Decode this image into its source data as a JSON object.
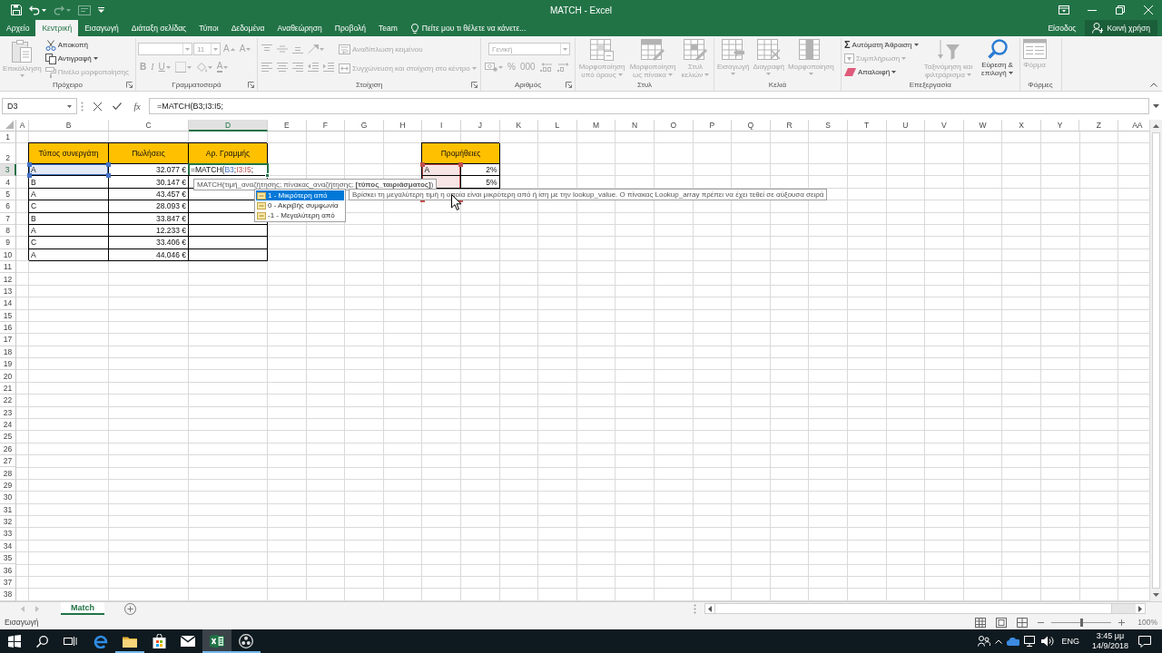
{
  "title_bar": {
    "title": "MATCH - Excel",
    "quick_access": [
      {
        "disabled": false
      },
      {
        "disabled": false
      },
      {
        "disabled": true
      },
      {
        "disabled": true
      },
      {
        "disabled": false
      }
    ]
  },
  "ribbon_tabs": [
    {
      "label": "Αρχείο",
      "selected": false
    },
    {
      "label": "Κεντρική",
      "selected": true
    },
    {
      "label": "Εισαγωγή",
      "selected": false
    },
    {
      "label": "Διάταξη σελίδας",
      "selected": false
    },
    {
      "label": "Τύποι",
      "selected": false
    },
    {
      "label": "Δεδομένα",
      "selected": false
    },
    {
      "label": "Αναθεώρηση",
      "selected": false
    },
    {
      "label": "Προβολή",
      "selected": false
    },
    {
      "label": "Team",
      "selected": false
    }
  ],
  "tell_me": {
    "label": "Πείτε μου τι θέλετε να κάνετε..."
  },
  "account": {
    "sign_in": "Είσοδος",
    "share": "Κοινή χρήση"
  },
  "ribbon_groups": [
    {
      "label": "Πρόχειρο",
      "launcher": true,
      "columns": [
        {
          "rows": [
            [
              {
                "kind": "large",
                "label": "Επικόλληση",
                "disabled": true
              }
            ]
          ]
        },
        {
          "rows": [
            [
              {
                "kind": "small",
                "label": "Αποκοπή",
                "disabled": false
              }
            ],
            [
              {
                "kind": "small",
                "label": "Αντιγραφή",
                "disabled": false
              }
            ],
            [
              {
                "kind": "small",
                "label": "Πινέλο μορφοποίησης",
                "disabled": true
              }
            ]
          ]
        }
      ]
    },
    {
      "label": "Γραμματοσειρά",
      "launcher": true,
      "columns": [
        {
          "rows": [
            [
              {
                "kind": "combo",
                "disabled": true
              },
              {
                "kind": "combo",
                "label": "11",
                "disabled": true
              },
              {
                "kind": "glyph",
                "label": "A",
                "disabled": true
              },
              {
                "kind": "glyph",
                "label": "A",
                "disabled": true
              }
            ],
            [
              {
                "kind": "glyph",
                "label": "B",
                "disabled": true
              },
              {
                "kind": "glyph",
                "label": "I",
                "disabled": true
              },
              {
                "kind": "glyph",
                "label": "U",
                "disabled": true
              },
              {
                "kind": "icon",
                "disabled": true
              },
              {
                "kind": "icon",
                "disabled": true
              },
              {
                "kind": "glyph",
                "label": "A",
                "disabled": true
              }
            ]
          ]
        }
      ]
    },
    {
      "label": "Στοίχιση",
      "launcher": true,
      "columns": [
        {
          "rows": [
            [
              {
                "kind": "icon",
                "disabled": true
              },
              {
                "kind": "icon",
                "disabled": true
              },
              {
                "kind": "icon",
                "disabled": true
              },
              {
                "kind": "icon",
                "disabled": true
              }
            ],
            [
              {
                "kind": "icon",
                "disabled": true
              },
              {
                "kind": "icon",
                "disabled": true
              },
              {
                "kind": "icon",
                "disabled": true
              },
              {
                "kind": "icon",
                "disabled": true
              },
              {
                "kind": "icon",
                "disabled": true
              }
            ]
          ]
        },
        {
          "rows": [
            [
              {
                "kind": "small",
                "label": "Αναδίπλωση κειμένου",
                "disabled": true
              }
            ],
            [
              {
                "kind": "small",
                "label": "Συγχώνευση και στοίχιση στο κέντρο",
                "disabled": true
              }
            ]
          ]
        }
      ]
    },
    {
      "label": "Αριθμός",
      "launcher": true,
      "columns": [
        {
          "rows": [
            [
              {
                "kind": "combo",
                "label": "Γενική",
                "disabled": true
              }
            ],
            [
              {
                "kind": "icon",
                "disabled": true
              },
              {
                "kind": "glyph",
                "label": "%",
                "disabled": true
              },
              {
                "kind": "glyph",
                "label": "000",
                "disabled": true
              },
              {
                "kind": "icon",
                "disabled": true
              },
              {
                "kind": "icon",
                "disabled": true
              }
            ]
          ]
        }
      ]
    },
    {
      "label": "Στυλ",
      "launcher": false,
      "columns": [
        {
          "rows": [
            [
              {
                "kind": "large",
                "label": "Μορφοποίηση υπό όρους",
                "disabled": true
              }
            ]
          ]
        },
        {
          "rows": [
            [
              {
                "kind": "large",
                "label": "Μορφοποίηση ως πίνακα",
                "disabled": true
              }
            ]
          ]
        },
        {
          "rows": [
            [
              {
                "kind": "large",
                "label": "Στυλ κελιών",
                "disabled": true
              }
            ]
          ]
        }
      ]
    },
    {
      "label": "Κελιά",
      "launcher": false,
      "columns": [
        {
          "rows": [
            [
              {
                "kind": "large",
                "label": "Εισαγωγή",
                "disabled": true
              }
            ]
          ]
        },
        {
          "rows": [
            [
              {
                "kind": "large",
                "label": "Διαγραφή",
                "disabled": true
              }
            ]
          ]
        },
        {
          "rows": [
            [
              {
                "kind": "large",
                "label": "Μορφοποίηση",
                "disabled": true
              }
            ]
          ]
        }
      ]
    },
    {
      "label": "Επεξεργασία",
      "launcher": false,
      "columns": [
        {
          "rows": [
            [
              {
                "kind": "small",
                "glyph": "Σ",
                "label": "Αυτόματη Άθροιση",
                "disabled": false
              }
            ],
            [
              {
                "kind": "small",
                "label": "Συμπλήρωση",
                "disabled": true
              }
            ],
            [
              {
                "kind": "small",
                "label": "Απαλοιφή",
                "disabled": false
              }
            ]
          ]
        },
        {
          "rows": [
            [
              {
                "kind": "large",
                "label": "Ταξινόμηση και φιλτράρισμα",
                "disabled": true
              }
            ]
          ]
        },
        {
          "rows": [
            [
              {
                "kind": "large",
                "label": "Εύρεση & επιλογή",
                "disabled": false
              }
            ]
          ]
        }
      ]
    },
    {
      "label": "Φόρμες",
      "launcher": false,
      "columns": [
        {
          "rows": [
            [
              {
                "kind": "large",
                "label": "Φόρμα",
                "disabled": true
              }
            ]
          ]
        }
      ]
    }
  ],
  "formula_bar": {
    "name_box": "D3",
    "function_button": "fx",
    "formula": "=MATCH(B3;I3:I5;"
  },
  "sheet": {
    "column_headers": [
      {
        "label": "A",
        "selected": false
      },
      {
        "label": "B",
        "selected": false
      },
      {
        "label": "C",
        "selected": false
      },
      {
        "label": "D",
        "selected": true
      },
      {
        "label": "E",
        "selected": false
      },
      {
        "label": "F",
        "selected": false
      },
      {
        "label": "G",
        "selected": false
      },
      {
        "label": "H",
        "selected": false
      },
      {
        "label": "I",
        "selected": false
      },
      {
        "label": "J",
        "selected": false
      },
      {
        "label": "K",
        "selected": false
      },
      {
        "label": "L",
        "selected": false
      },
      {
        "label": "M",
        "selected": false
      },
      {
        "label": "N",
        "selected": false
      },
      {
        "label": "O",
        "selected": false
      },
      {
        "label": "P",
        "selected": false
      },
      {
        "label": "Q",
        "selected": false
      },
      {
        "label": "R",
        "selected": false
      },
      {
        "label": "S",
        "selected": false
      },
      {
        "label": "T",
        "selected": false
      },
      {
        "label": "U",
        "selected": false
      },
      {
        "label": "V",
        "selected": false
      },
      {
        "label": "W",
        "selected": false
      },
      {
        "label": "X",
        "selected": false
      },
      {
        "label": "Y",
        "selected": false
      },
      {
        "label": "Z",
        "selected": false
      },
      {
        "label": "AA",
        "selected": false
      }
    ],
    "row_headers": [
      {
        "label": "1",
        "selected": false
      },
      {
        "label": "2",
        "selected": false
      },
      {
        "label": "3",
        "selected": true
      },
      {
        "label": "4",
        "selected": false
      },
      {
        "label": "5",
        "selected": false
      },
      {
        "label": "6",
        "selected": false
      },
      {
        "label": "7",
        "selected": false
      },
      {
        "label": "8",
        "selected": false
      },
      {
        "label": "9",
        "selected": false
      },
      {
        "label": "10",
        "selected": false
      },
      {
        "label": "11",
        "selected": false
      },
      {
        "label": "12",
        "selected": false
      },
      {
        "label": "13",
        "selected": false
      },
      {
        "label": "14",
        "selected": false
      },
      {
        "label": "15",
        "selected": false
      },
      {
        "label": "16",
        "selected": false
      },
      {
        "label": "17",
        "selected": false
      },
      {
        "label": "18",
        "selected": false
      },
      {
        "label": "19",
        "selected": false
      },
      {
        "label": "20",
        "selected": false
      },
      {
        "label": "21",
        "selected": false
      },
      {
        "label": "22",
        "selected": false
      },
      {
        "label": "23",
        "selected": false
      },
      {
        "label": "24",
        "selected": false
      },
      {
        "label": "25",
        "selected": false
      },
      {
        "label": "26",
        "selected": false
      },
      {
        "label": "27",
        "selected": false
      },
      {
        "label": "28",
        "selected": false
      },
      {
        "label": "29",
        "selected": false
      },
      {
        "label": "30",
        "selected": false
      },
      {
        "label": "31",
        "selected": false
      },
      {
        "label": "32",
        "selected": false
      },
      {
        "label": "33",
        "selected": false
      },
      {
        "label": "34",
        "selected": false
      },
      {
        "label": "35",
        "selected": false
      },
      {
        "label": "36",
        "selected": false
      },
      {
        "label": "37",
        "selected": false
      },
      {
        "label": "38",
        "selected": false
      }
    ],
    "sales_table": {
      "columns": [
        "Τύπος συνεργάτη",
        "Πωλήσεις",
        "Αρ. Γραμμής"
      ],
      "rows": [
        {
          "partner_type": "A",
          "sales": "32.077 €",
          "formula_parts": [
            {
              "text": "=MATCH("
            },
            {
              "text": "B3",
              "color": "#4472c4"
            },
            {
              "text": ";"
            },
            {
              "text": "I3:I5",
              "color": "#c0504d"
            },
            {
              "text": ";"
            }
          ]
        },
        {
          "partner_type": "B",
          "sales": "30.147 €"
        },
        {
          "partner_type": "A",
          "sales": "43.457 €"
        },
        {
          "partner_type": "C",
          "sales": "28.093 €"
        },
        {
          "partner_type": "B",
          "sales": "33.847 €"
        },
        {
          "partner_type": "A",
          "sales": "12.233 €"
        },
        {
          "partner_type": "C",
          "sales": "33.406 €"
        },
        {
          "partner_type": "A",
          "sales": "44.046 €"
        }
      ]
    },
    "commission_table": {
      "title": "Προμήθειες",
      "rows": [
        {
          "partner_type": "A",
          "rate": "2%"
        },
        {
          "rate": "5%"
        }
      ]
    },
    "syntax_tip": "MATCH(τιμή_αναζήτησης; πίνακας_αναζήτησης; **[τύπος_ταιριάσματος]**)",
    "autocomplete": [
      {
        "label": "1 - Μικρότερη από",
        "selected": true
      },
      {
        "label": "0 - Ακριβής συμφωνία",
        "selected": false
      },
      {
        "label": "-1 - Μεγαλύτερη από",
        "selected": false
      }
    ],
    "description_tip": "Βρίσκει τη μεγαλύτερη τιμή η οποία είναι μικρότερη από ή ίση με την lookup_value. Ο πίνακας Lookup_array πρέπει να έχει τεθεί σε αύξουσα σειρά"
  },
  "sheet_tabs": [
    {
      "label": "Match",
      "selected": true
    }
  ],
  "status_bar": {
    "text": "Εισαγωγή",
    "zoom": {
      "level": 0.5,
      "label": "100%"
    }
  },
  "taskbar": {
    "apps": [
      {
        "running": false,
        "selected": false
      },
      {
        "running": true,
        "selected": false
      },
      {
        "running": false,
        "selected": false
      },
      {
        "running": false,
        "selected": false
      },
      {
        "running": true,
        "selected": true
      },
      {
        "running": true,
        "selected": false
      }
    ],
    "language": "ENG",
    "time": "3:45 μμ",
    "date": "14/9/2018"
  }
}
